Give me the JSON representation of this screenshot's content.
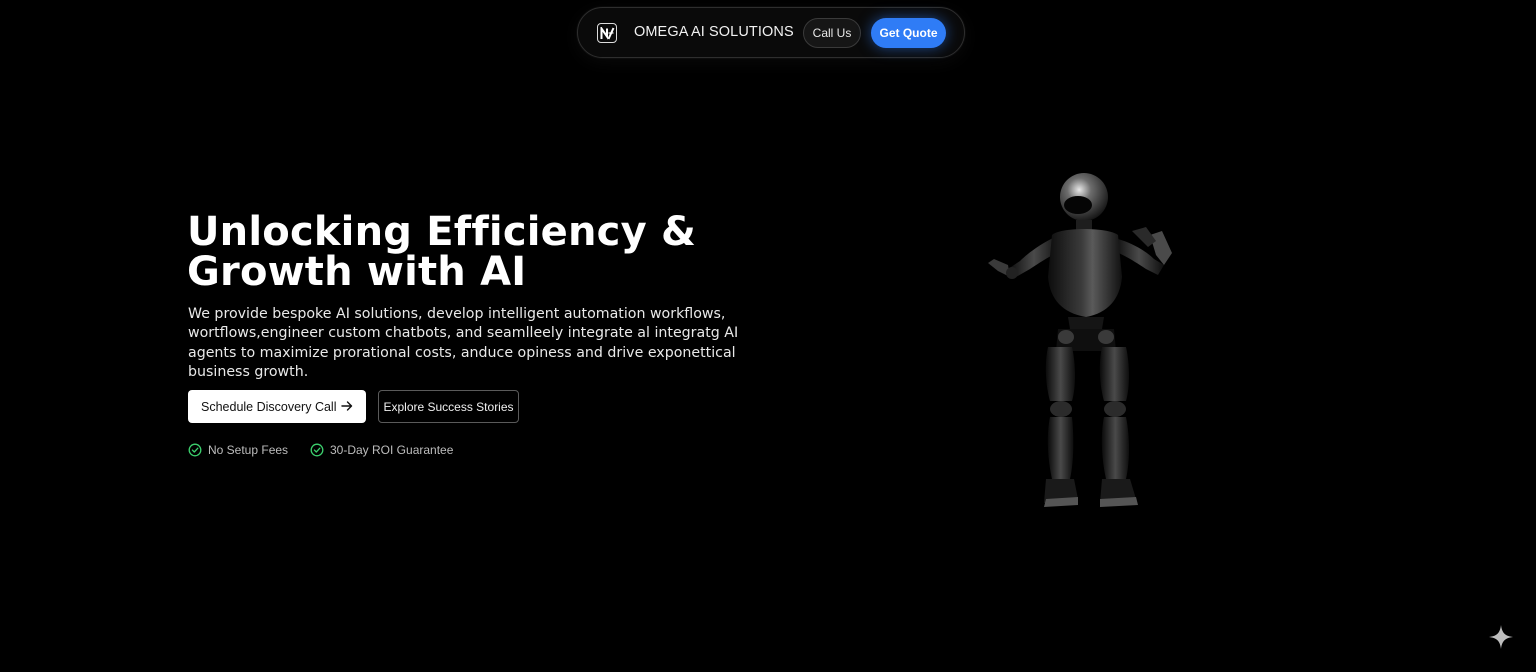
{
  "nav": {
    "logo_icon": "omega-n-logo-icon",
    "brand_name": "OMEGA AI SOLUTIONS",
    "call_label": "Call Us",
    "quote_label": "Get Quote"
  },
  "hero": {
    "title": "Unlocking Efficiency & Growth with AI",
    "subtitle": "We provide bespoke AI solutions, develop intelligent automation workflows, wortflows,engineer custom chatbots, and seamlleely integrate al integratg AI agents to maximize prorational costs, anduce opiness and drive exponettical business growth.",
    "primary_cta": "Schedule Discovery Call",
    "primary_cta_icon": "arrow-right-icon",
    "secondary_cta": "Explore Success Stories",
    "features": [
      {
        "icon": "check-circle-icon",
        "label": "No Setup Fees"
      },
      {
        "icon": "check-circle-icon",
        "label": "30-Day ROI Guarantee"
      }
    ]
  },
  "illustration": {
    "icon": "humanoid-robot-illustration"
  },
  "corner": {
    "icon": "sparkle-icon"
  },
  "colors": {
    "background": "#000000",
    "accent": "#2f7cf6",
    "check_green": "#3ccf6d",
    "text_primary": "#ffffff",
    "text_muted": "#bdbdbd"
  }
}
